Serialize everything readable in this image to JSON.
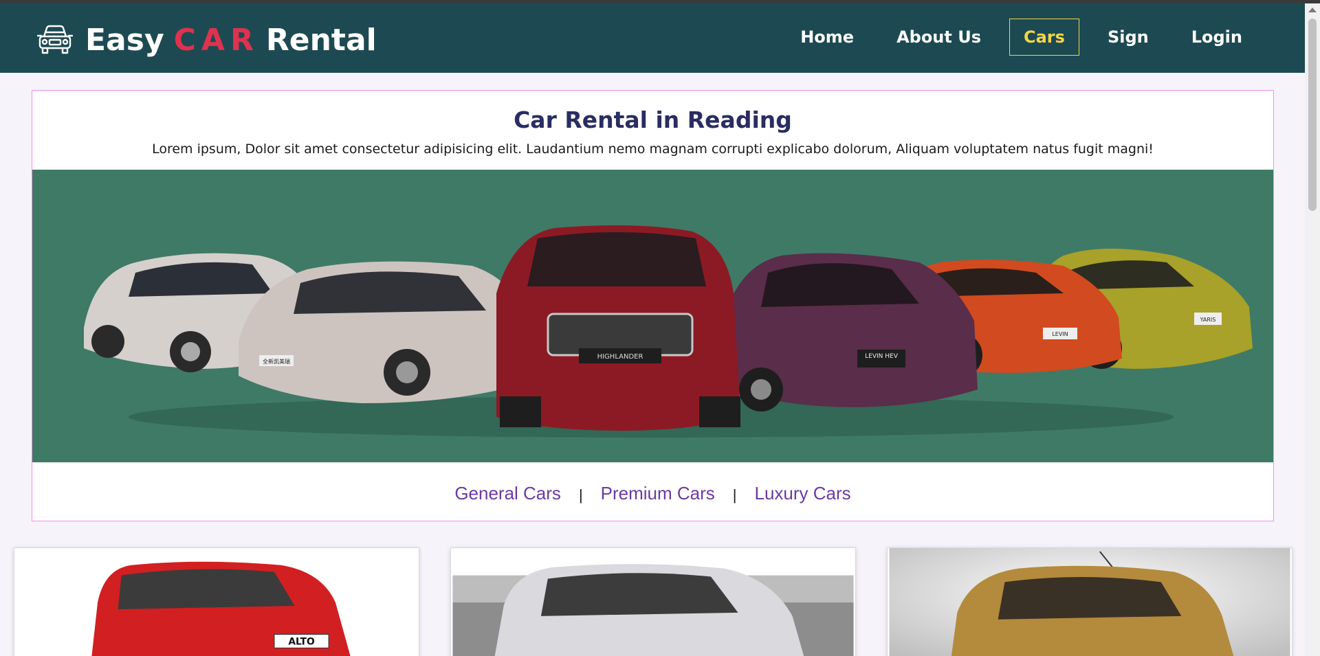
{
  "header": {
    "brand_prefix": "Easy",
    "brand_accent": "CAR",
    "brand_suffix": "Rental",
    "brand_icon": "car-front-icon",
    "nav": [
      {
        "label": "Home",
        "active": false
      },
      {
        "label": "About Us",
        "active": false
      },
      {
        "label": "Cars",
        "active": true
      },
      {
        "label": "Sign",
        "active": false
      },
      {
        "label": "Login",
        "active": false
      }
    ]
  },
  "hero": {
    "title": "Car Rental in Reading",
    "description": "Lorem ipsum, Dolor sit amet consectetur adipisicing elit. Laudantium nemo magnam corrupti explicabo dolorum, Aliquam voluptatem natus fugit magni!",
    "banner_plate_texts": [
      "HIGHLANDER",
      "LEVIN HEV",
      "LEVIN",
      "全新凯美瑞"
    ],
    "categories": [
      "General Cars",
      "Premium Cars",
      "Luxury Cars"
    ],
    "separator": "|"
  },
  "cars": [
    {
      "color": "red",
      "plate": "ALTO"
    },
    {
      "color": "silver",
      "plate": ""
    },
    {
      "color": "gold",
      "plate": ""
    }
  ],
  "colors": {
    "navbar": "#1d4a52",
    "brand_accent": "#e0314f",
    "active_nav": "#f5d547",
    "title": "#2a2d62",
    "category_link": "#6b3aa2",
    "banner_bg": "#3f7a66",
    "card_border": "#f58ee6"
  }
}
